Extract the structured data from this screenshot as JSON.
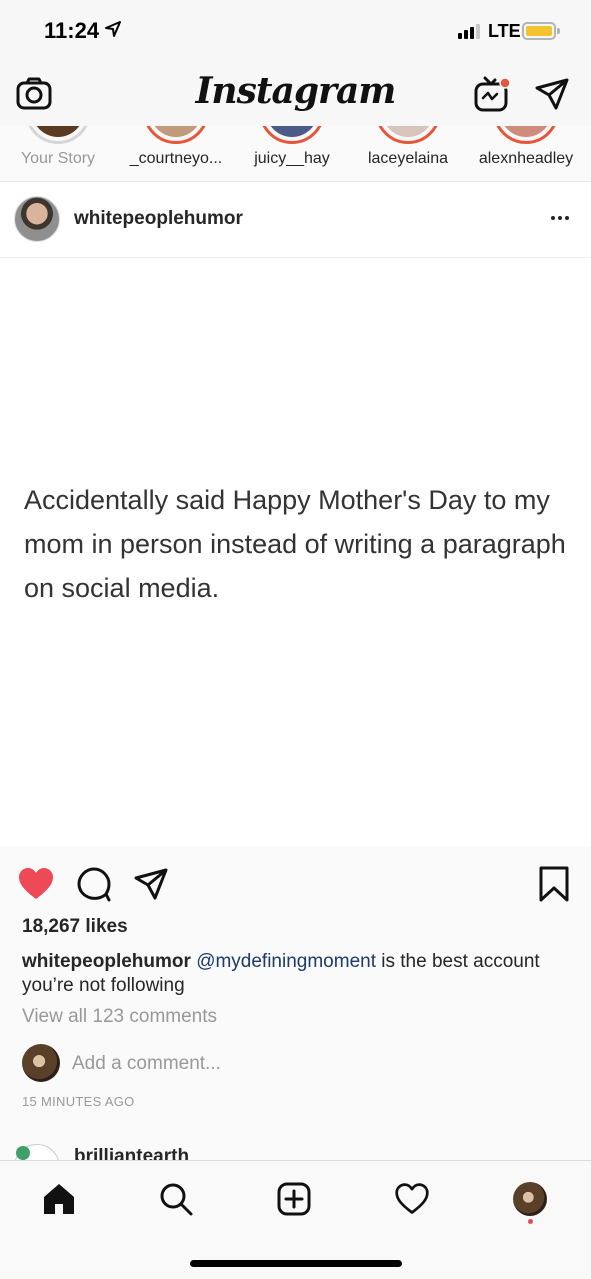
{
  "status_bar": {
    "time": "11:24",
    "network": "LTE",
    "location_icon": "location-arrow-icon",
    "battery_color": "#f4c430"
  },
  "nav": {
    "logo": "Instagram",
    "icons": [
      "camera-icon",
      "igtv-icon",
      "direct-send-icon"
    ],
    "notification_dot_color": "#e5573a"
  },
  "stories": [
    {
      "label": "Your Story",
      "seen": true
    },
    {
      "label": "_courtneyo...",
      "seen": false
    },
    {
      "label": "juicy__hay",
      "seen": false
    },
    {
      "label": "laceyelaina",
      "seen": false
    },
    {
      "label": "alexnheadley",
      "seen": false
    }
  ],
  "post": {
    "username": "whitepeoplehumor",
    "image_text": "Accidentally said Happy Mother's Day to my mom in person instead of writing a paragraph on social media.",
    "liked": true,
    "like_color": "#ed4956",
    "likes": "18,267 likes",
    "caption": {
      "username": "whitepeoplehumor",
      "mention": "@mydefiningmoment",
      "text": " is the best account you’re not following"
    },
    "view_comments": "View all 123 comments",
    "add_comment_placeholder": "Add a comment...",
    "timestamp": "15 MINUTES AGO"
  },
  "next_post": {
    "username": "brilliantearth"
  },
  "tab_bar": {
    "tabs": [
      "home-icon",
      "search-icon",
      "new-post-icon",
      "activity-heart-icon",
      "profile-avatar"
    ],
    "active": "home-icon"
  }
}
